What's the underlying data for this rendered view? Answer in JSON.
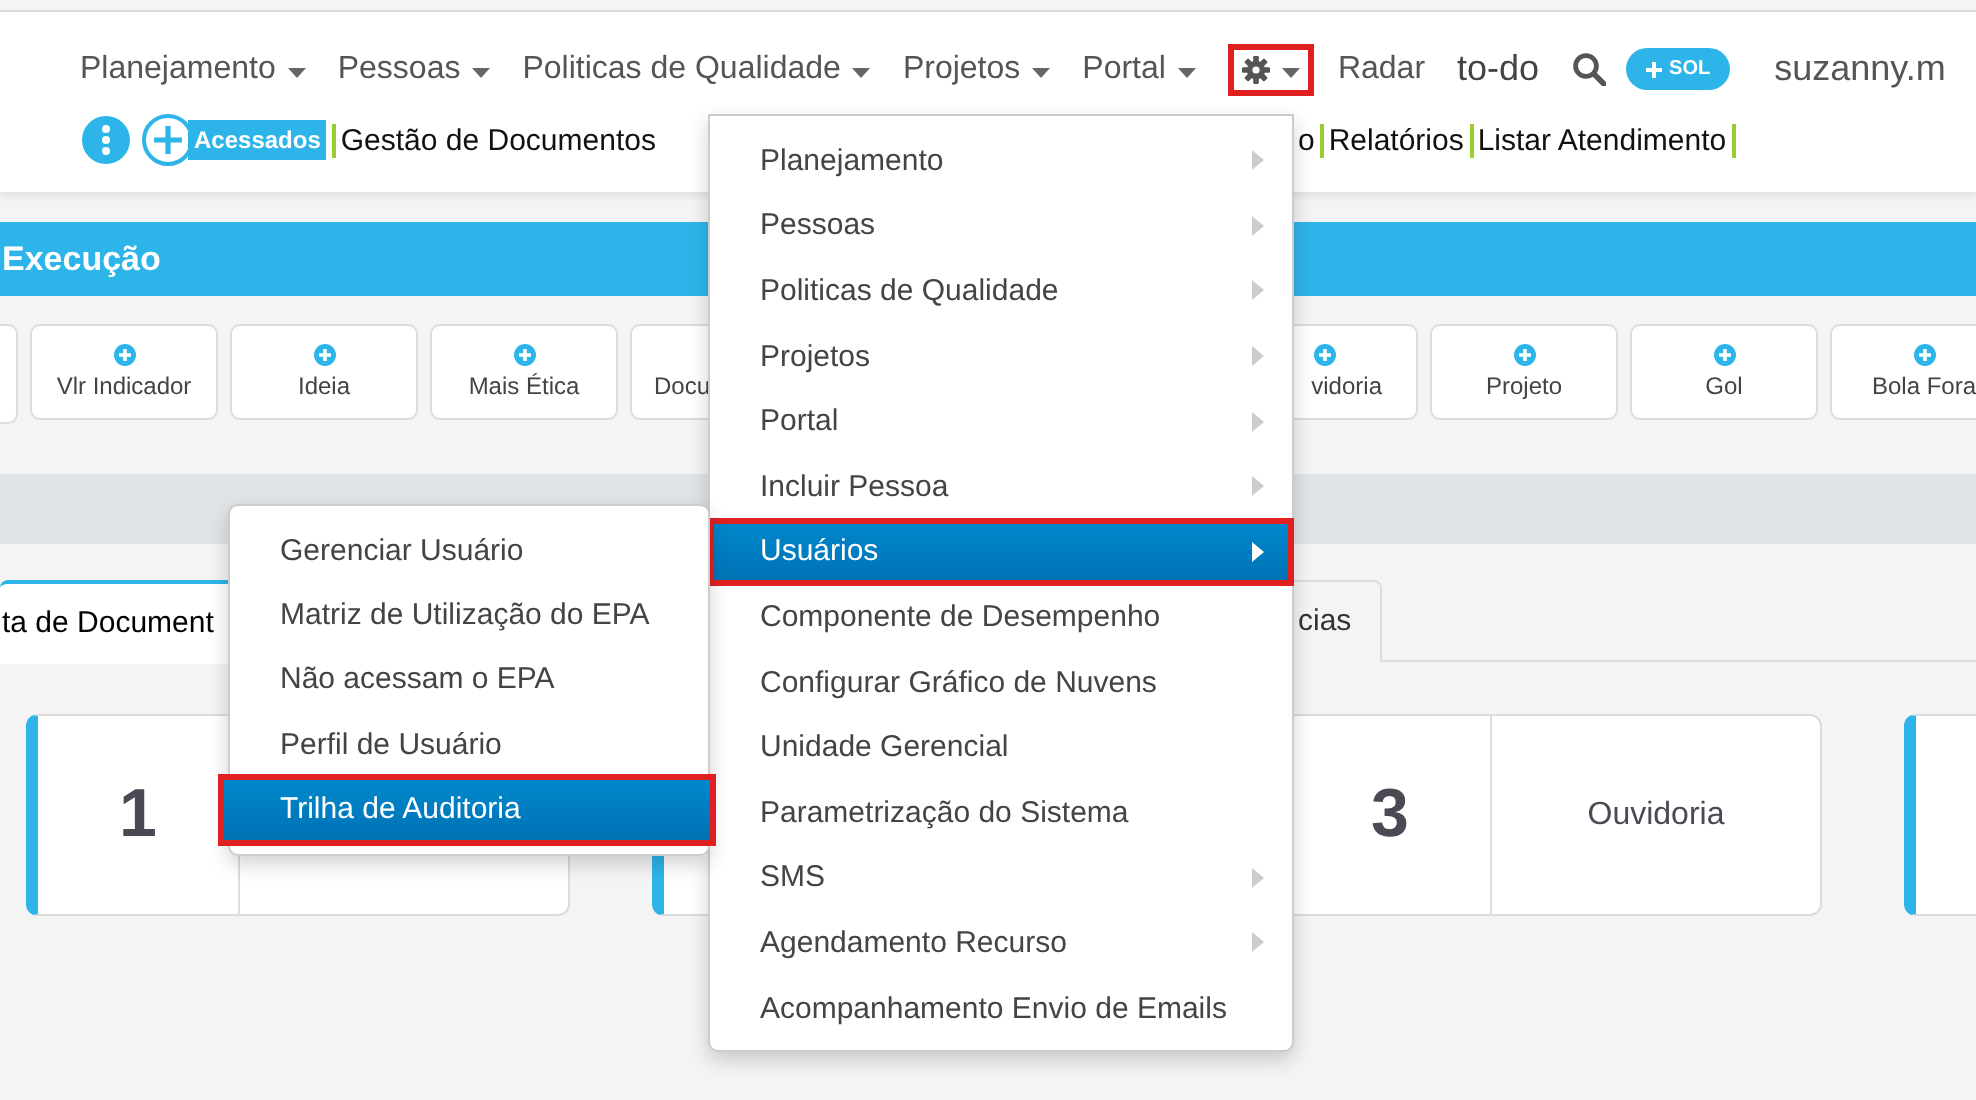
{
  "nav": {
    "items": [
      {
        "kind": "dropdown",
        "label": "Planejamento",
        "highlighted": false
      },
      {
        "kind": "dropdown",
        "label": "Pessoas",
        "highlighted": false
      },
      {
        "kind": "dropdown",
        "label": "Politicas de Qualidade",
        "highlighted": false
      },
      {
        "kind": "dropdown",
        "label": "Projetos",
        "highlighted": false
      },
      {
        "kind": "dropdown",
        "label": "Portal",
        "highlighted": false
      },
      {
        "kind": "gear",
        "highlighted": true
      },
      {
        "kind": "link",
        "label": "Radar",
        "highlighted": false
      },
      {
        "kind": "strong",
        "label": "to-do",
        "highlighted": false
      },
      {
        "kind": "search",
        "highlighted": false
      },
      {
        "kind": "pill",
        "label": "SOL",
        "highlighted": false
      }
    ],
    "user": "suzanny.m",
    "accessed_label": "Acessados",
    "shortcuts": [
      {
        "label": "Gestão de Documentos"
      },
      {
        "label": "o"
      },
      {
        "label": "Relatórios"
      },
      {
        "label": "Listar Atendimento"
      }
    ]
  },
  "section_title": "Execução",
  "quick_buttons": [
    {
      "kind": "full",
      "label": "Vlr Indicador"
    },
    {
      "kind": "full",
      "label": "Ideia"
    },
    {
      "kind": "full",
      "label": "Mais Ética"
    },
    {
      "kind": "cut_right",
      "label": "Docu"
    },
    {
      "kind": "cut_left",
      "label": "vidoria"
    },
    {
      "kind": "full",
      "label": "Projeto"
    },
    {
      "kind": "full",
      "label": "Gol"
    },
    {
      "kind": "full",
      "label": "Bola Fora"
    }
  ],
  "tabs": [
    {
      "label": "ta de Document",
      "selected": true
    },
    {
      "label": "cias",
      "selected": false
    }
  ],
  "cards": [
    {
      "kind": "stat",
      "number": "1"
    },
    {
      "kind": "stat"
    },
    {
      "kind": "stat",
      "number": "3",
      "label": "Ouvidoria"
    },
    {
      "kind": "stat"
    }
  ],
  "menu": [
    {
      "label": "Planejamento",
      "has_submenu": true,
      "selected": false
    },
    {
      "label": "Pessoas",
      "has_submenu": true,
      "selected": false
    },
    {
      "label": "Politicas de Qualidade",
      "has_submenu": true,
      "selected": false
    },
    {
      "label": "Projetos",
      "has_submenu": true,
      "selected": false
    },
    {
      "label": "Portal",
      "has_submenu": true,
      "selected": false
    },
    {
      "label": "Incluir Pessoa",
      "has_submenu": true,
      "selected": false
    },
    {
      "label": "Usuários",
      "has_submenu": true,
      "selected": true
    },
    {
      "label": "Componente de Desempenho",
      "has_submenu": false,
      "selected": false
    },
    {
      "label": "Configurar Gráfico de Nuvens",
      "has_submenu": false,
      "selected": false
    },
    {
      "label": "Unidade Gerencial",
      "has_submenu": false,
      "selected": false
    },
    {
      "label": "Parametrização do Sistema",
      "has_submenu": false,
      "selected": false
    },
    {
      "label": "SMS",
      "has_submenu": true,
      "selected": false
    },
    {
      "label": "Agendamento Recurso",
      "has_submenu": true,
      "selected": false
    },
    {
      "label": "Acompanhamento Envio de Emails",
      "has_submenu": false,
      "selected": false
    }
  ],
  "submenu": [
    {
      "label": "Gerenciar Usuário",
      "selected": false
    },
    {
      "label": "Matriz de Utilização do EPA",
      "selected": false
    },
    {
      "label": "Não acessam o EPA",
      "selected": false
    },
    {
      "label": "Perfil de Usuário",
      "selected": false
    },
    {
      "label": "Trilha de Auditoria",
      "selected": true
    }
  ]
}
